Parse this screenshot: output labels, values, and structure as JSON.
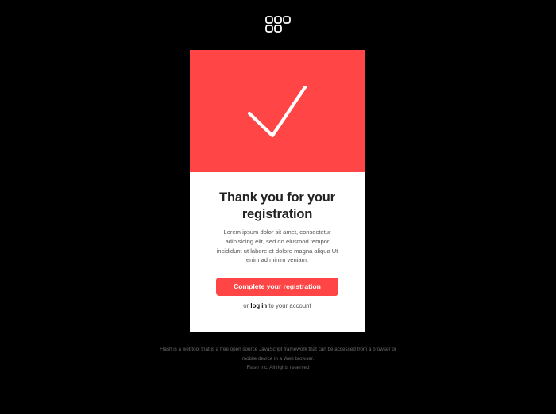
{
  "brand": {
    "logo_icon": "grid-logo-icon",
    "accent_color": "#ff4545",
    "background_color": "#000000"
  },
  "card": {
    "hero_icon": "checkmark-icon",
    "title": "Thank you for your registration",
    "description": "Lorem ipsum dolor sit amet, consectetur adipisicing elit, sed do eiusmod tempor incididunt ut labore et dolore magna aliqua Ut enim ad minim veniam.",
    "cta_label": "Complete your registration",
    "login_prefix": "or ",
    "login_link": "log in",
    "login_suffix": " to your account"
  },
  "footer": {
    "description": "Flash is a webtool that is a free open source JavaScript framework that can be accessed from a browser or mobile device in a Web browser.",
    "copyright": "Flash Inc. All rights reserved"
  }
}
